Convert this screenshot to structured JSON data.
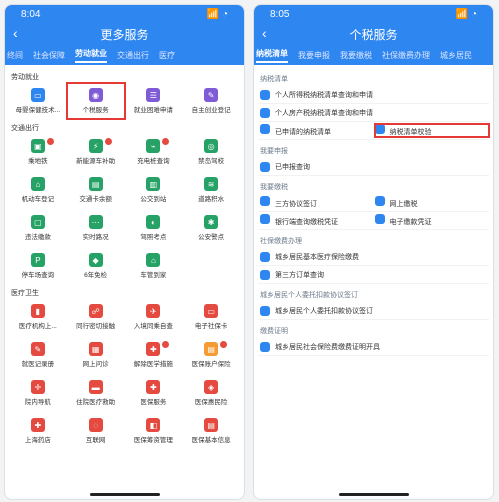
{
  "left": {
    "status_time": "8:04",
    "status_right": "📶 ◔",
    "title": "更多服务",
    "tabs": [
      "终间",
      "社会保障",
      "劳动就业",
      "交通出行",
      "医疗"
    ],
    "active_tab": 2,
    "sections": [
      {
        "title": "劳动就业",
        "items": [
          "母婴保健技术...",
          "个税服务",
          "就业困难申请",
          "自主创业登记"
        ]
      },
      {
        "title": "交通出行",
        "items": [
          "乘地铁",
          "新能源车补助",
          "充电桩查询",
          "禁岛驾校",
          "机动车登记",
          "交通卡余额",
          "公交到站",
          "道路积水",
          "违法缴款",
          "实时路况",
          "驾照考点",
          "公安警点",
          "停车场查询",
          "6年免检",
          "车管到家"
        ]
      },
      {
        "title": "医疗卫生",
        "items": [
          "医疗机构上...",
          "同行密切接触",
          "入境同乘自查",
          "电子社保卡",
          "就医记录册",
          "网上问诊",
          "解除医学措施",
          "医保账户保险",
          "院内导航",
          "住院医疗救助",
          "医保服务",
          "医保惠民险",
          "上海药店",
          "互联网",
          "医保筹资管理",
          "医保基本信息"
        ]
      }
    ]
  },
  "right": {
    "status_time": "8:05",
    "status_right": "📶 ◔",
    "title": "个税服务",
    "tabs": [
      "纳税清单",
      "我要申报",
      "我要缴税",
      "社保缴费办理",
      "城乡居民"
    ],
    "active_tab": 0,
    "sections": [
      {
        "title": "纳税清单",
        "rows": [
          "个人所得税纳税清单查询和申请",
          "个人房产税纳税清单查询和申请"
        ],
        "pair": [
          "已申请的纳税清单",
          "纳税清单校验"
        ]
      },
      {
        "title": "我要申报",
        "rows": [
          "已申报查询"
        ]
      },
      {
        "title": "我要缴税",
        "pairs": [
          [
            "三方协议签订",
            "网上缴税"
          ],
          [
            "银行端查询缴税凭证",
            "电子缴款凭证"
          ]
        ]
      },
      {
        "title": "社保缴费办理",
        "rows": [
          "城乡居民基本医疗保险缴费",
          "第三方订单查询"
        ]
      },
      {
        "title": "城乡居民个人委托扣款协议签订",
        "rows": [
          "城乡居民个人委托扣款协议签订"
        ]
      },
      {
        "title": "缴费证明",
        "rows": [
          "城乡居民社会保险费缴费证明开具"
        ]
      }
    ]
  },
  "colors": {
    "primary": "#2e86f1",
    "highlight": "#e53935"
  }
}
